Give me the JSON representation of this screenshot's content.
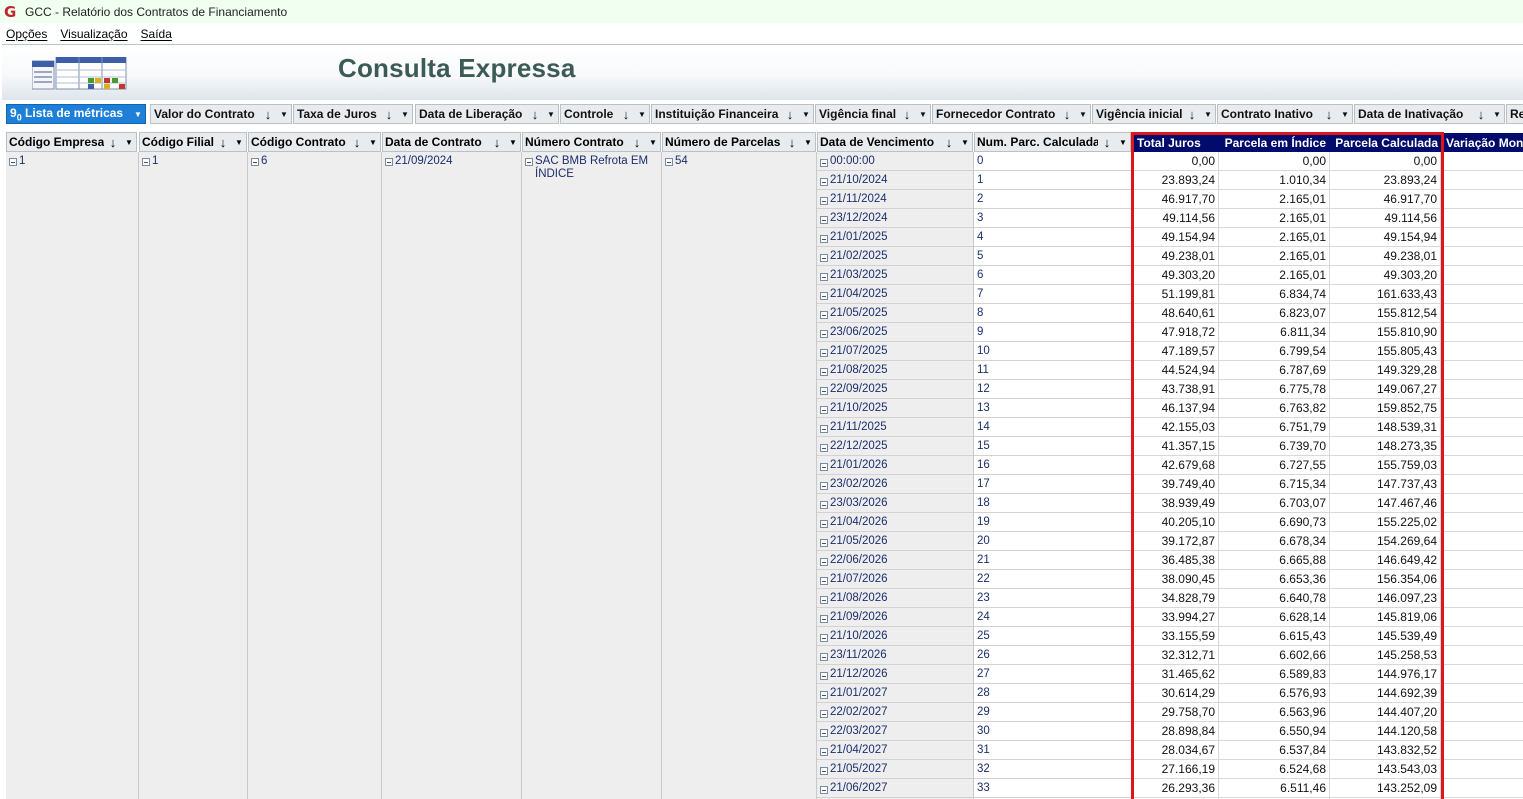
{
  "window": {
    "title": "GCC - Relatório dos Contratos de Financiamento",
    "logo_glyph": "G"
  },
  "menu": [
    "Opções",
    "Visualização",
    "Saída"
  ],
  "header": {
    "title": "Consulta Expressa",
    "icon": "grid-report-icon"
  },
  "filters": [
    "Lista de métricas",
    "Valor do Contrato",
    "Taxa de Juros",
    "Data de Liberação",
    "Controle",
    "Instituição Financeira",
    "Vigência final",
    "Fornecedor Contrato",
    "Vigência inicial",
    "Contrato Inativo",
    "Data de Inativação",
    "Re"
  ],
  "metrics_prefix": "9",
  "metrics_sub": "0",
  "columns": [
    "Código Empresa",
    "Código Filial",
    "Código Contrato",
    "Data de Contrato",
    "Número Contrato",
    "Número de Parcelas",
    "Data de Vencimento",
    "Num. Parc. Calculada"
  ],
  "metric_columns": [
    "Total Juros",
    "Parcela em Índice",
    "Parcela Calculada",
    "Variação Mon"
  ],
  "record": {
    "codigo_empresa": "1",
    "codigo_filial": "1",
    "codigo_contrato": "6",
    "data_contrato": "21/09/2024",
    "numero_contrato": "SAC BMB Refrota EM ÍNDICE",
    "numero_parcelas": "54"
  },
  "rows": [
    {
      "venc": "00:00:00",
      "parc": "0",
      "juros": "0,00",
      "indice": "0,00",
      "calc": "0,00"
    },
    {
      "venc": "21/10/2024",
      "parc": "1",
      "juros": "23.893,24",
      "indice": "1.010,34",
      "calc": "23.893,24"
    },
    {
      "venc": "21/11/2024",
      "parc": "2",
      "juros": "46.917,70",
      "indice": "2.165,01",
      "calc": "46.917,70"
    },
    {
      "venc": "23/12/2024",
      "parc": "3",
      "juros": "49.114,56",
      "indice": "2.165,01",
      "calc": "49.114,56"
    },
    {
      "venc": "21/01/2025",
      "parc": "4",
      "juros": "49.154,94",
      "indice": "2.165,01",
      "calc": "49.154,94"
    },
    {
      "venc": "21/02/2025",
      "parc": "5",
      "juros": "49.238,01",
      "indice": "2.165,01",
      "calc": "49.238,01"
    },
    {
      "venc": "21/03/2025",
      "parc": "6",
      "juros": "49.303,20",
      "indice": "2.165,01",
      "calc": "49.303,20"
    },
    {
      "venc": "21/04/2025",
      "parc": "7",
      "juros": "51.199,81",
      "indice": "6.834,74",
      "calc": "161.633,43"
    },
    {
      "venc": "21/05/2025",
      "parc": "8",
      "juros": "48.640,61",
      "indice": "6.823,07",
      "calc": "155.812,54"
    },
    {
      "venc": "23/06/2025",
      "parc": "9",
      "juros": "47.918,72",
      "indice": "6.811,34",
      "calc": "155.810,90"
    },
    {
      "venc": "21/07/2025",
      "parc": "10",
      "juros": "47.189,57",
      "indice": "6.799,54",
      "calc": "155.805,43"
    },
    {
      "venc": "21/08/2025",
      "parc": "11",
      "juros": "44.524,94",
      "indice": "6.787,69",
      "calc": "149.329,28"
    },
    {
      "venc": "22/09/2025",
      "parc": "12",
      "juros": "43.738,91",
      "indice": "6.775,78",
      "calc": "149.067,27"
    },
    {
      "venc": "21/10/2025",
      "parc": "13",
      "juros": "46.137,94",
      "indice": "6.763,82",
      "calc": "159.852,75"
    },
    {
      "venc": "21/11/2025",
      "parc": "14",
      "juros": "42.155,03",
      "indice": "6.751,79",
      "calc": "148.539,31"
    },
    {
      "venc": "22/12/2025",
      "parc": "15",
      "juros": "41.357,15",
      "indice": "6.739,70",
      "calc": "148.273,35"
    },
    {
      "venc": "21/01/2026",
      "parc": "16",
      "juros": "42.679,68",
      "indice": "6.727,55",
      "calc": "155.759,03"
    },
    {
      "venc": "23/02/2026",
      "parc": "17",
      "juros": "39.749,40",
      "indice": "6.715,34",
      "calc": "147.737,43"
    },
    {
      "venc": "23/03/2026",
      "parc": "18",
      "juros": "38.939,49",
      "indice": "6.703,07",
      "calc": "147.467,46"
    },
    {
      "venc": "21/04/2026",
      "parc": "19",
      "juros": "40.205,10",
      "indice": "6.690,73",
      "calc": "155.225,02"
    },
    {
      "venc": "21/05/2026",
      "parc": "20",
      "juros": "39.172,87",
      "indice": "6.678,34",
      "calc": "154.269,64"
    },
    {
      "venc": "22/06/2026",
      "parc": "21",
      "juros": "36.485,38",
      "indice": "6.665,88",
      "calc": "146.649,42"
    },
    {
      "venc": "21/07/2026",
      "parc": "22",
      "juros": "38.090,45",
      "indice": "6.653,36",
      "calc": "156.354,06"
    },
    {
      "venc": "21/08/2026",
      "parc": "23",
      "juros": "34.828,79",
      "indice": "6.640,78",
      "calc": "146.097,23"
    },
    {
      "venc": "21/09/2026",
      "parc": "24",
      "juros": "33.994,27",
      "indice": "6.628,14",
      "calc": "145.819,06"
    },
    {
      "venc": "21/10/2026",
      "parc": "25",
      "juros": "33.155,59",
      "indice": "6.615,43",
      "calc": "145.539,49"
    },
    {
      "venc": "23/11/2026",
      "parc": "26",
      "juros": "32.312,71",
      "indice": "6.602,66",
      "calc": "145.258,53"
    },
    {
      "venc": "21/12/2026",
      "parc": "27",
      "juros": "31.465,62",
      "indice": "6.589,83",
      "calc": "144.976,17"
    },
    {
      "venc": "21/01/2027",
      "parc": "28",
      "juros": "30.614,29",
      "indice": "6.576,93",
      "calc": "144.692,39"
    },
    {
      "venc": "22/02/2027",
      "parc": "29",
      "juros": "29.758,70",
      "indice": "6.563,96",
      "calc": "144.407,20"
    },
    {
      "venc": "22/03/2027",
      "parc": "30",
      "juros": "28.898,84",
      "indice": "6.550,94",
      "calc": "144.120,58"
    },
    {
      "venc": "21/04/2027",
      "parc": "31",
      "juros": "28.034,67",
      "indice": "6.537,84",
      "calc": "143.832,52"
    },
    {
      "venc": "21/05/2027",
      "parc": "32",
      "juros": "27.166,19",
      "indice": "6.524,68",
      "calc": "143.543,03"
    },
    {
      "venc": "21/06/2027",
      "parc": "33",
      "juros": "26.293,36",
      "indice": "6.511,46",
      "calc": "143.252,09"
    }
  ],
  "colors": {
    "metric_header": "#000b6b",
    "highlight_border": "#e0141b",
    "metrics_chip": "#1d7fd8",
    "title_color": "#3d5b55"
  }
}
